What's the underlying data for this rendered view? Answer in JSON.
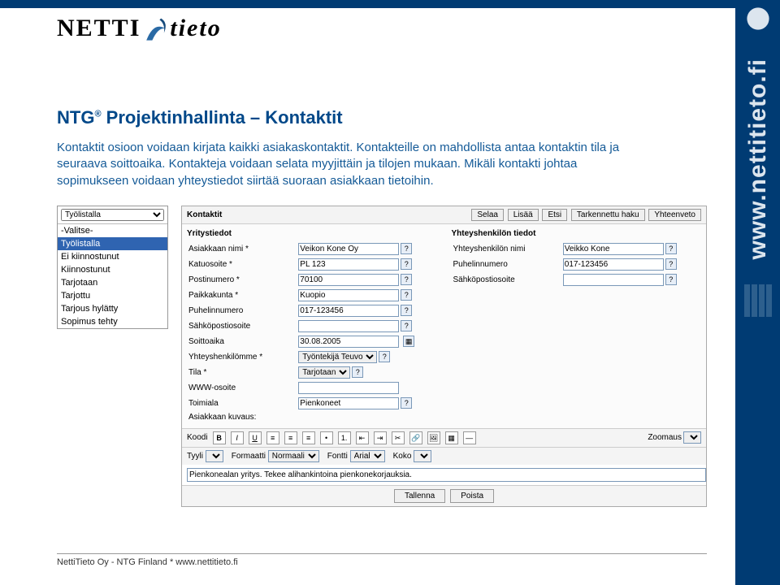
{
  "brand": {
    "name1": "NETTI",
    "name2": "tieto",
    "url": "www.nettitieto.fi",
    "dotfi": ".fi"
  },
  "heading": {
    "prefix": "NTG",
    "reg": "®",
    "suffix": " Projektinhallinta – Kontaktit"
  },
  "paragraph": "Kontaktit osioon voidaan kirjata kaikki asiakaskontaktit. Kontakteille on mahdollista antaa kontaktin tila ja seuraava soittoaika. Kontakteja voidaan selata myyjittäin ja tilojen mukaan. Mikäli kontakti johtaa sopimukseen voidaan yhteystiedot siirtää suoraan asiakkaan tietoihin.",
  "status": {
    "select_placeholder": "Työlistalla",
    "items": [
      "-Valitse-",
      "Työlistalla",
      "Ei kiinnostunut",
      "Kiinnostunut",
      "Tarjotaan",
      "Tarjottu",
      "Tarjous hylätty",
      "Sopimus tehty"
    ],
    "selected": "Työlistalla"
  },
  "panel": {
    "title": "Kontaktit",
    "buttons": [
      "Selaa",
      "Lisää",
      "Etsi",
      "Tarkennettu haku",
      "Yhteenveto"
    ]
  },
  "yritys": {
    "section": "Yritystiedot",
    "fields": {
      "asiakas": {
        "label": "Asiakkaan nimi *",
        "value": "Veikon Kone Oy"
      },
      "katuosoite": {
        "label": "Katuosoite *",
        "value": "PL 123"
      },
      "postinro": {
        "label": "Postinumero *",
        "value": "70100"
      },
      "paikkakunta": {
        "label": "Paikkakunta *",
        "value": "Kuopio"
      },
      "puhelin": {
        "label": "Puhelinnumero",
        "value": "017-123456"
      },
      "sahkoposti": {
        "label": "Sähköpostiosoite",
        "value": ""
      },
      "soittoaika": {
        "label": "Soittoaika",
        "value": "30.08.2005"
      },
      "yhteyshenk_omme": {
        "label": "Yhteyshenkilömme *",
        "value": "Työntekijä Teuvo"
      },
      "tila": {
        "label": "Tila *",
        "value": "Tarjotaan"
      },
      "www": {
        "label": "WWW-osoite",
        "value": ""
      },
      "toimiala": {
        "label": "Toimiala",
        "value": "Pienkoneet"
      },
      "kuvaus": {
        "label": "Asiakkaan kuvaus:"
      }
    }
  },
  "yhteys": {
    "section": "Yhteyshenkilön tiedot",
    "fields": {
      "nimi": {
        "label": "Yhteyshenkilön nimi",
        "value": "Veikko Kone"
      },
      "puhelin": {
        "label": "Puhelinnumero",
        "value": "017-123456"
      },
      "sahkoposti": {
        "label": "Sähköpostiosoite",
        "value": ""
      }
    }
  },
  "editor_toolbar": {
    "koodi": "Koodi",
    "tyyli": "Tyyli",
    "tyyli_v": "",
    "formaatti": "Formaatti",
    "formaatti_v": "Normaali",
    "fontti": "Fontti",
    "fontti_v": "Arial",
    "koko": "Koko",
    "zoomaus": "Zoomaus"
  },
  "editor_value": "Pienkonealan yritys. Tekee alihankintoina pienkonekorjauksia.",
  "footer_buttons": {
    "save": "Tallenna",
    "delete": "Poista"
  },
  "page_footer": "NettiTieto Oy - NTG Finland   *   www.nettitieto.fi"
}
